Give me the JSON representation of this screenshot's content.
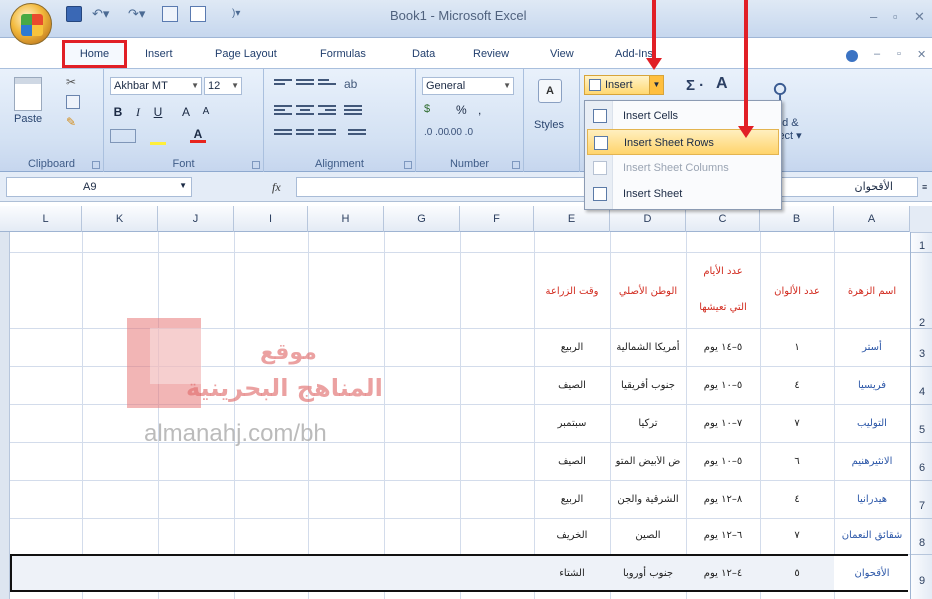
{
  "title_bar": {
    "window_title": "Book1 - Microsoft Excel"
  },
  "tabs": [
    "Home",
    "Insert",
    "Page Layout",
    "Formulas",
    "Data",
    "Review",
    "View",
    "Add-Ins"
  ],
  "ribbon": {
    "clipboard": {
      "paste": "Paste",
      "label": "Clipboard"
    },
    "font": {
      "name": "Akhbar MT",
      "size": "12",
      "label": "Font"
    },
    "alignment": {
      "label": "Alignment"
    },
    "number": {
      "format": "General",
      "currency": "$",
      "percent": "%",
      "comma": ",",
      "inc_decimal": ".0 .00",
      "dec_decimal": ".00 .0",
      "label": "Number"
    },
    "styles": {
      "label": "Styles"
    },
    "cells": {
      "insert": "Insert"
    },
    "editing": {
      "find": "nd &",
      "select": "lect"
    }
  },
  "insert_menu": [
    {
      "label": "Insert Cells",
      "enabled": true
    },
    {
      "label": "Insert Sheet Rows",
      "enabled": true,
      "highlighted": true
    },
    {
      "label": "Insert Sheet Columns",
      "enabled": false
    },
    {
      "label": "Insert Sheet",
      "enabled": true
    }
  ],
  "formula_bar": {
    "name_box": "A9",
    "fx": "fx",
    "value": "الأقحوان"
  },
  "columns": [
    "L",
    "K",
    "J",
    "I",
    "H",
    "G",
    "F",
    "E",
    "D",
    "C",
    "B",
    "A"
  ],
  "rows": [
    "1",
    "2",
    "3",
    "4",
    "5",
    "6",
    "7",
    "8",
    "9"
  ],
  "table": {
    "headers": {
      "a": "اسم الزهرة",
      "b": "عدد الألوان",
      "c1": "عدد الأيام",
      "c2": "التي تعيشها",
      "d": "الوطن الأصلي",
      "e": "وقت الزراعة"
    },
    "rows": [
      {
        "a": "أستر",
        "b": "١",
        "c": "٥–١٤ يوم",
        "d": "أمريكا الشمالية",
        "e": "الربيع"
      },
      {
        "a": "فريسيا",
        "b": "٤",
        "c": "٥–١٠ يوم",
        "d": "جنوب أفريقيا",
        "e": "الصيف"
      },
      {
        "a": "التوليب",
        "b": "٧",
        "c": "٧–١٠ يوم",
        "d": "تركيا",
        "e": "سبتمبر"
      },
      {
        "a": "الانثيرهنيم",
        "b": "٦",
        "c": "٥–١٠ يوم",
        "d": "ض الأبيض المتو",
        "e": "الصيف"
      },
      {
        "a": "هيدرانيا",
        "b": "٤",
        "c": "٨–١٢ يوم",
        "d": "الشرقية والجن",
        "e": "الربيع"
      },
      {
        "a": "شقائق النعمان",
        "b": "٧",
        "c": "٦–١٢ يوم",
        "d": "الصين",
        "e": "الخريف"
      },
      {
        "a": "الأقحوان",
        "b": "٥",
        "c": "٤–١٢ يوم",
        "d": "جنوب أوروبا",
        "e": "الشتاء"
      }
    ]
  },
  "watermark": {
    "line1": "موقع",
    "line2": "المناهج البحرينية",
    "url": "almanahj.com/bh"
  }
}
